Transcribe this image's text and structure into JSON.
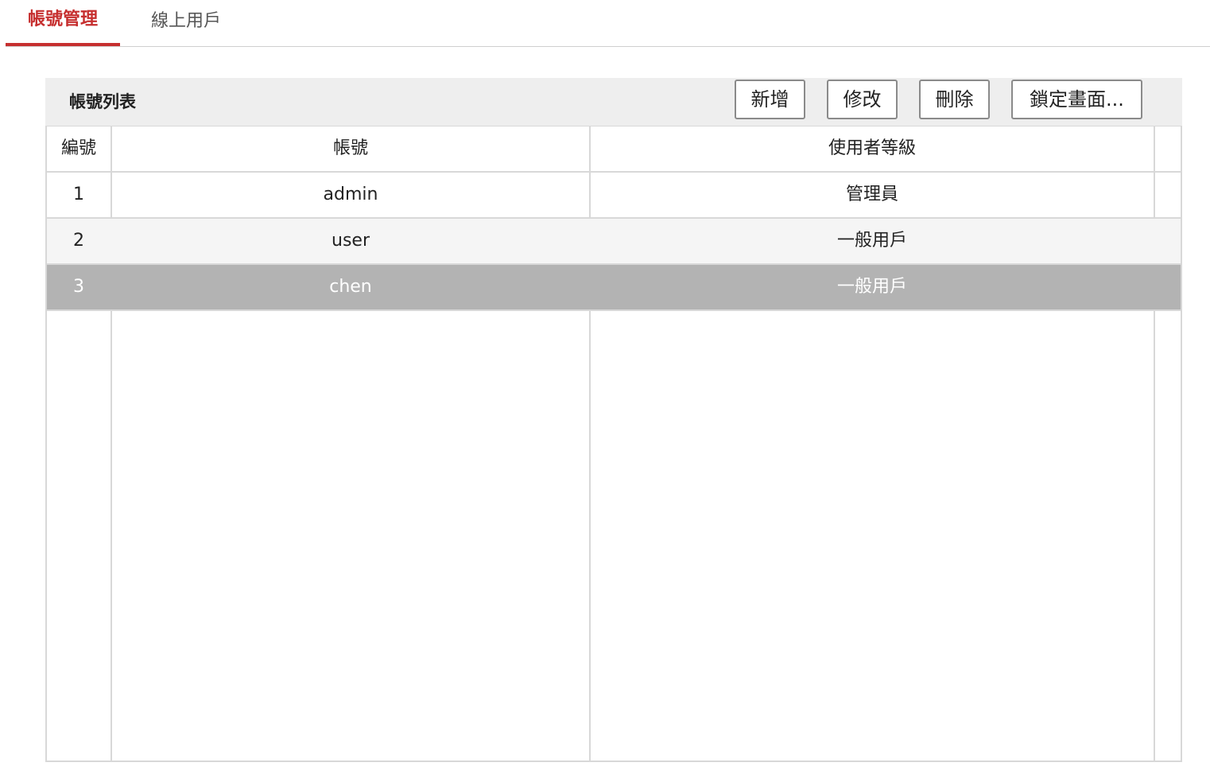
{
  "tabs": [
    {
      "label": "帳號管理"
    },
    {
      "label": "線上用戶"
    }
  ],
  "panel": {
    "title": "帳號列表",
    "buttons": {
      "add": "新增",
      "edit": "修改",
      "delete": "刪除",
      "lock": "鎖定畫面..."
    }
  },
  "table": {
    "headers": [
      "編號",
      "帳號",
      "使用者等級"
    ],
    "rows": [
      {
        "id": "1",
        "account": "admin",
        "level": "管理員"
      },
      {
        "id": "2",
        "account": "user",
        "level": "一般用戶"
      },
      {
        "id": "3",
        "account": "chen",
        "level": "一般用戶"
      }
    ]
  },
  "colors": {
    "accent": "#c62f2f",
    "selected_row": "#b3b3b3",
    "header_bg": "#eeeeee"
  }
}
